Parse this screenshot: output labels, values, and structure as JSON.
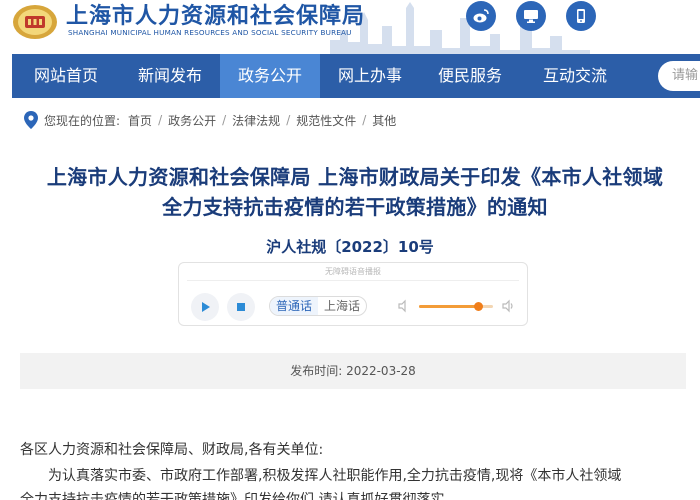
{
  "header": {
    "site_name": "上海市人力资源和社会保障局",
    "site_name_en": "SHANGHAI MUNICIPAL HUMAN RESOURCES AND SOCIAL SECURITY BUREAU",
    "icons": [
      "weibo-icon",
      "computer-icon",
      "mobile-icon"
    ]
  },
  "nav": {
    "items": [
      {
        "label": "网站首页"
      },
      {
        "label": "新闻发布"
      },
      {
        "label": "政务公开"
      },
      {
        "label": "网上办事"
      },
      {
        "label": "便民服务"
      },
      {
        "label": "互动交流"
      }
    ],
    "active_index": 2,
    "search_placeholder": "请输"
  },
  "breadcrumb": {
    "label": "您现在的位置:",
    "items": [
      "首页",
      "政务公开",
      "法律法规",
      "规范性文件",
      "其他"
    ]
  },
  "article": {
    "title_line1": "上海市人力资源和社会保障局 上海市财政局关于印发《本市人社领域",
    "title_line2": "全力支持抗击疫情的若干政策措施》的通知",
    "doc_number": "沪人社规〔2022〕10号",
    "publish_label": "发布时间:",
    "publish_date": "2022-03-28",
    "salutation": "各区人力资源和社会保障局、财政局,各有关单位:",
    "para1": "为认真落实市委、市政府工作部署,积极发挥人社职能作用,全力抗击疫情,现将《本市人社领域",
    "para2": "全力支持抗击疫情的若干政策措施》印发给你们,请认真抓好贯彻落实。"
  },
  "player": {
    "caption": "无障碍语音播报",
    "voice_options": [
      "普通话",
      "上海话"
    ],
    "selected_voice": "普通话",
    "volume": 0.8
  },
  "colors": {
    "brand_blue": "#2c5ea8",
    "nav_active": "#4a86d4",
    "title_blue": "#1a3c7a",
    "volume_orange": "#f07e1a"
  }
}
